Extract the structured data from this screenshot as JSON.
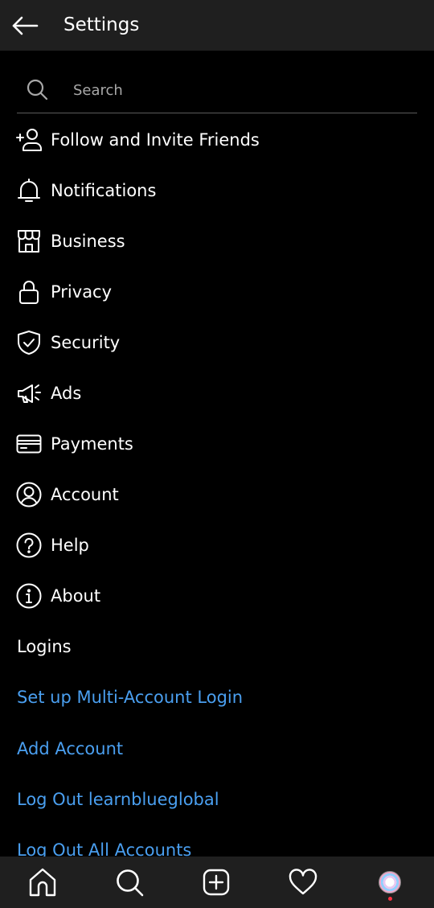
{
  "header": {
    "title": "Settings"
  },
  "search": {
    "placeholder": "Search"
  },
  "menu": [
    {
      "label": "Follow and Invite Friends",
      "icon": "add-person-icon"
    },
    {
      "label": "Notifications",
      "icon": "bell-icon"
    },
    {
      "label": "Business",
      "icon": "storefront-icon"
    },
    {
      "label": "Privacy",
      "icon": "lock-icon"
    },
    {
      "label": "Security",
      "icon": "shield-check-icon"
    },
    {
      "label": "Ads",
      "icon": "megaphone-icon"
    },
    {
      "label": "Payments",
      "icon": "credit-card-icon"
    },
    {
      "label": "Account",
      "icon": "account-circle-icon"
    },
    {
      "label": "Help",
      "icon": "help-circle-icon"
    },
    {
      "label": "About",
      "icon": "info-circle-icon"
    }
  ],
  "logins": {
    "section_label": "Logins",
    "links": [
      "Set up Multi-Account Login",
      "Add Account",
      "Log Out learnblueglobal",
      "Log Out All Accounts"
    ]
  },
  "bottom_nav": [
    "home-icon",
    "search-icon",
    "new-post-icon",
    "activity-heart-icon",
    "profile-avatar"
  ],
  "colors": {
    "background": "#000000",
    "bar": "#1f1f1f",
    "link": "#4a9ff0",
    "notification_dot": "#ff3040"
  }
}
